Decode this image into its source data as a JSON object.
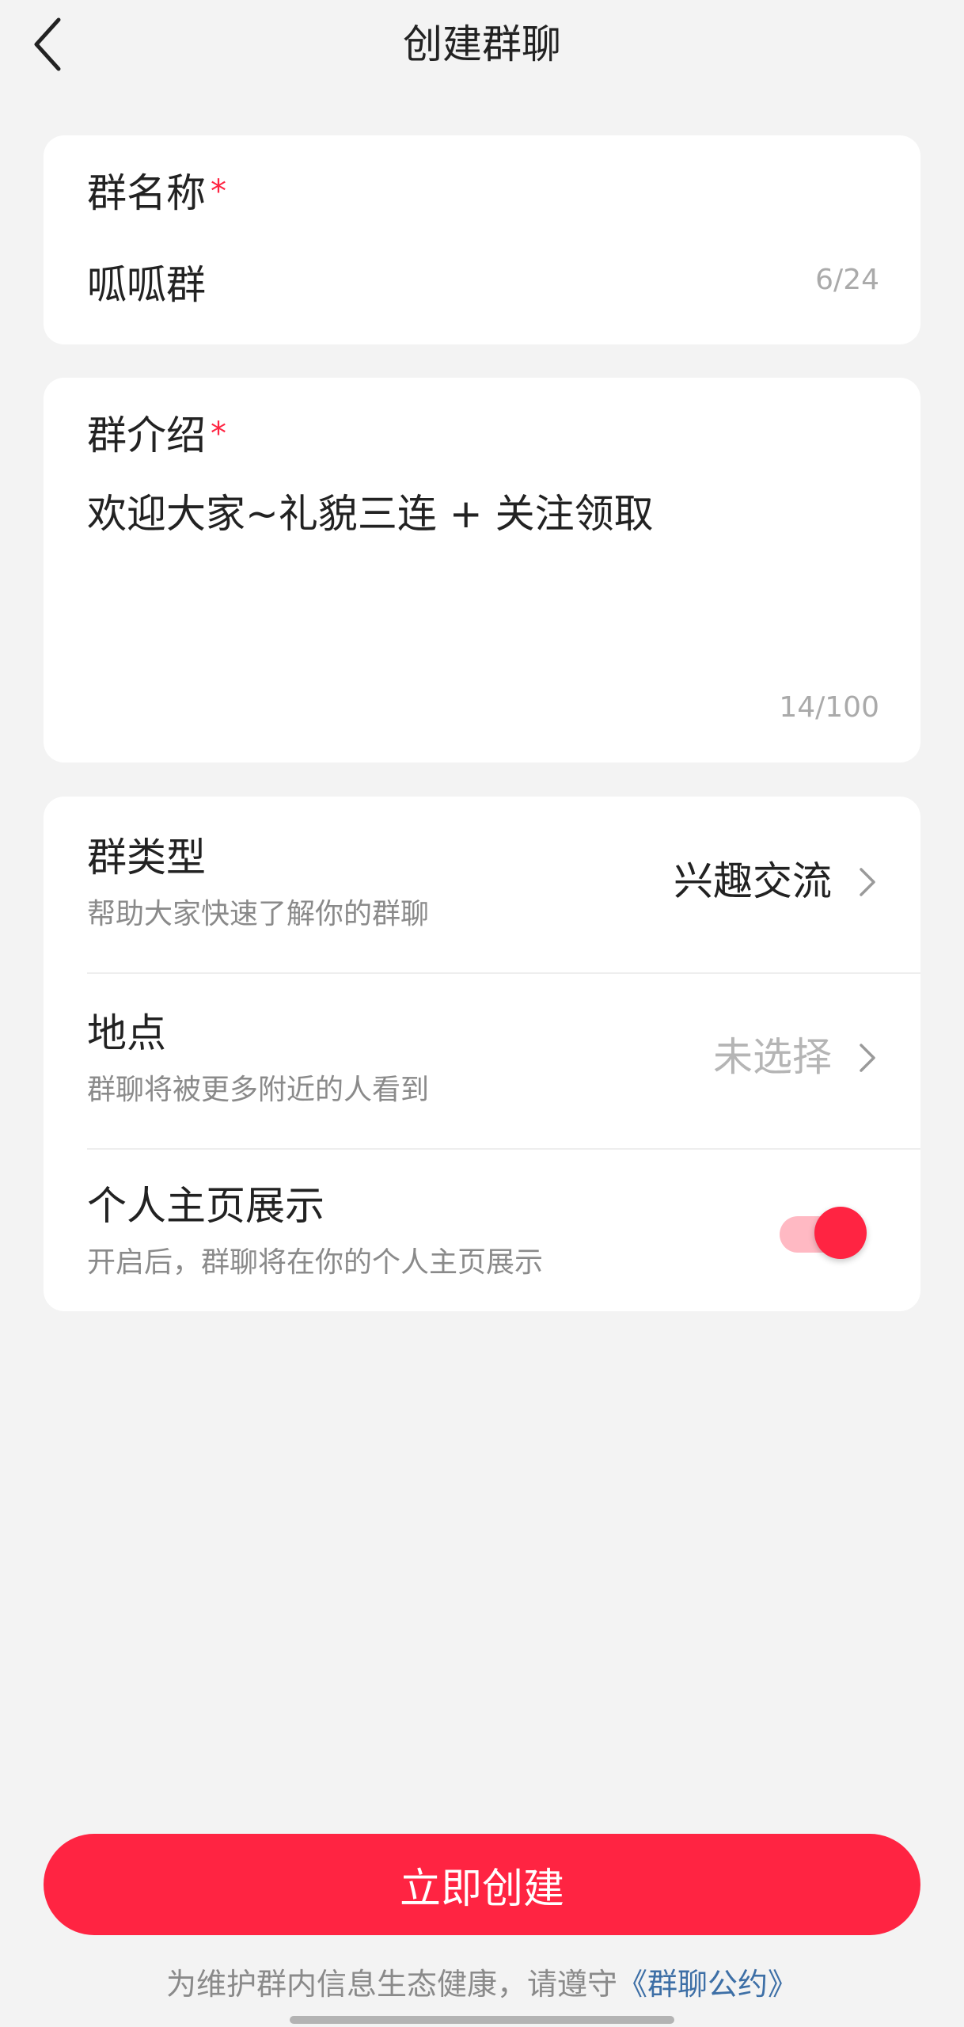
{
  "header": {
    "title": "创建群聊",
    "back_icon": "chevron-left-icon"
  },
  "group_name": {
    "label": "群名称",
    "required_mark": "*",
    "value": "呱呱群",
    "counter": "6/24"
  },
  "group_intro": {
    "label": "群介绍",
    "required_mark": "*",
    "value": "欢迎大家~礼貌三连 + 关注领取",
    "counter": "14/100"
  },
  "settings": {
    "type": {
      "title": "群类型",
      "subtitle": "帮助大家快速了解你的群聊",
      "value": "兴趣交流",
      "icon": "chevron-right-icon"
    },
    "location": {
      "title": "地点",
      "subtitle": "群聊将被更多附近的人看到",
      "value": "未选择",
      "icon": "chevron-right-icon"
    },
    "profile_display": {
      "title": "个人主页展示",
      "subtitle": "开启后，群聊将在你的个人主页展示",
      "enabled": true
    }
  },
  "footer": {
    "create_button": "立即创建",
    "notice_prefix": "为维护群内信息生态健康，请遵守",
    "notice_link": "《群聊公约》"
  },
  "colors": {
    "accent": "#ff2442",
    "toggle_track": "#ffb9c3",
    "link": "#3d6fa6",
    "background": "#f3f3f3",
    "card": "#ffffff"
  }
}
